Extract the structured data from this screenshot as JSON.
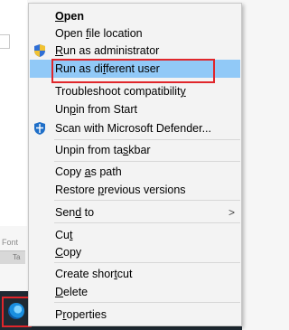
{
  "menu": {
    "items": [
      {
        "label": "Open",
        "underline_index": 0
      },
      {
        "label": "Open file location",
        "underline_index": 5
      },
      {
        "label": "Run as administrator",
        "underline_index": 0
      },
      {
        "label": "Run as different user",
        "underline_index": 9
      },
      {
        "label": "Troubleshoot compatibility",
        "underline_index": 25
      },
      {
        "label": "Unpin from Start",
        "underline_index": 2
      },
      {
        "label": "Scan with Microsoft Defender...",
        "underline_index": -1
      },
      {
        "label": "Unpin from taskbar",
        "underline_index": 13
      },
      {
        "label": "Copy as path",
        "underline_index": 5
      },
      {
        "label": "Restore previous versions",
        "underline_index": 8
      },
      {
        "label": "Send to",
        "underline_index": 3
      },
      {
        "label": "Cut",
        "underline_index": 2
      },
      {
        "label": "Copy",
        "underline_index": 0
      },
      {
        "label": "Create shortcut",
        "underline_index": 11
      },
      {
        "label": "Delete",
        "underline_index": 0
      },
      {
        "label": "Properties",
        "underline_index": 1
      }
    ],
    "submenu_arrow": ">"
  },
  "background": {
    "font_label": "Font",
    "tab_label": "Ta"
  },
  "icons": {
    "run_as_admin": "uac-shield-icon",
    "scan": "defender-shield-icon",
    "taskbar_app": "edge-icon"
  },
  "colors": {
    "selected_bg": "#91c9f7",
    "highlight_border": "#e0262b",
    "menu_bg": "#f3f3f3",
    "taskbar_bg": "#1f2a33"
  }
}
